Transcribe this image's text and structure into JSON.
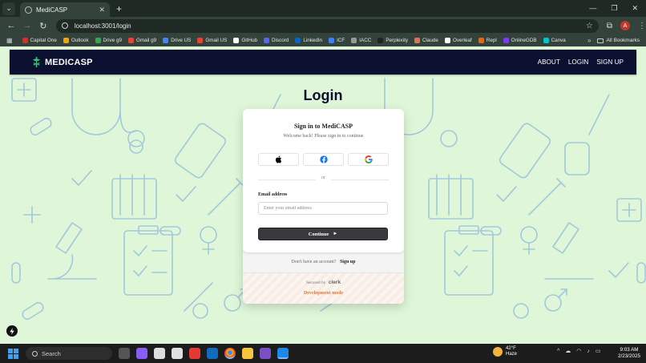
{
  "browser": {
    "tab_title": "MediCASP",
    "url": "localhost:3001/login",
    "profile_initial": "A",
    "all_bookmarks_label": "All Bookmarks",
    "bookmarks": [
      {
        "label": "Capital One",
        "color": "#c0392b"
      },
      {
        "label": "Outlook",
        "color": "#f0a500"
      },
      {
        "label": "Drive g9",
        "color": "#34a853"
      },
      {
        "label": "Gmail g9",
        "color": "#ea4335"
      },
      {
        "label": "Drive US",
        "color": "#4285f4"
      },
      {
        "label": "Gmail US",
        "color": "#ea4335"
      },
      {
        "label": "GitHub",
        "color": "#ffffff"
      },
      {
        "label": "Discord",
        "color": "#5865f2"
      },
      {
        "label": "LinkedIn",
        "color": "#0a66c2"
      },
      {
        "label": "ICF",
        "color": "#3b82f6"
      },
      {
        "label": "IACC",
        "color": "#999999"
      },
      {
        "label": "Perplexity",
        "color": "#222222"
      },
      {
        "label": "Claude",
        "color": "#d97757"
      },
      {
        "label": "Overleaf",
        "color": "#ffffff"
      },
      {
        "label": "Repl",
        "color": "#f26207"
      },
      {
        "label": "OnlineGDB",
        "color": "#7c3aed"
      },
      {
        "label": "Canva",
        "color": "#00c4cc"
      }
    ]
  },
  "site": {
    "brand": "MEDICASP",
    "nav": [
      "ABOUT",
      "LOGIN",
      "SIGN UP"
    ],
    "heading": "Login"
  },
  "login": {
    "title": "Sign in to MediCASP",
    "subtitle": "Welcome back! Please sign in to continue",
    "social": [
      "apple-icon",
      "facebook-icon",
      "google-icon"
    ],
    "divider": "or",
    "email_label": "Email address",
    "email_placeholder": "Enter your email address",
    "email_value": "",
    "continue_label": "Continue",
    "continue_arrow": "►",
    "no_account_text": "Don't have an account?",
    "signup_link": "Sign up",
    "secured_by": "Secured by",
    "clerk": "clerk",
    "dev_mode": "Development mode"
  },
  "taskbar": {
    "search_placeholder": "Search",
    "weather_temp": "42°F",
    "weather_desc": "Haze",
    "time": "9:03 AM",
    "date": "2/23/2025"
  },
  "colors": {
    "page_bg": "#dff7d8",
    "navbar": "#0b1030",
    "button": "#3a3a3e",
    "dev_mode": "#e8793b"
  }
}
